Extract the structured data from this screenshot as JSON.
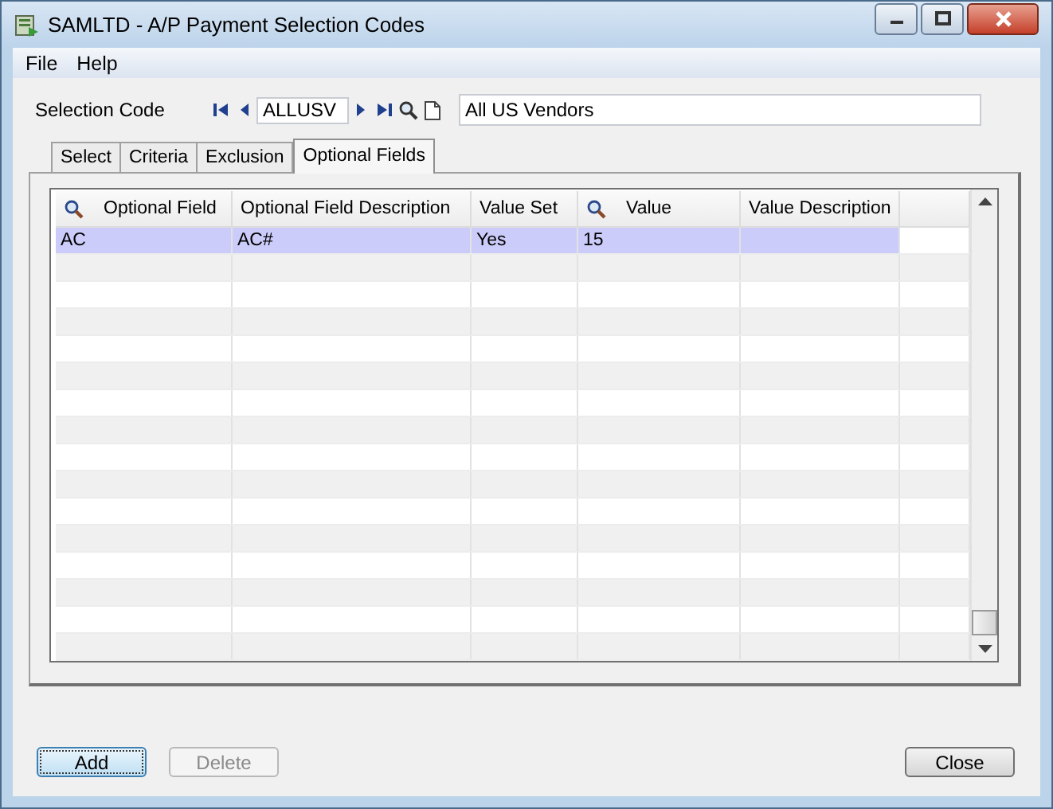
{
  "window": {
    "title": "SAMLTD - A/P Payment Selection Codes"
  },
  "menu": [
    "File",
    "Help"
  ],
  "selection_code": {
    "label": "Selection Code",
    "value": "ALLUSV",
    "description": "All US Vendors"
  },
  "tabs": [
    {
      "label": "Select",
      "selected": false
    },
    {
      "label": "Criteria",
      "selected": false
    },
    {
      "label": "Exclusion",
      "selected": false
    },
    {
      "label": "Optional Fields",
      "selected": true
    }
  ],
  "table": {
    "columns": [
      {
        "label": "Optional Field",
        "lookup": true
      },
      {
        "label": "Optional Field Description",
        "lookup": false
      },
      {
        "label": "Value Set",
        "lookup": false
      },
      {
        "label": "Value",
        "lookup": true
      },
      {
        "label": "Value Description",
        "lookup": false
      }
    ],
    "rows": [
      {
        "cells": [
          "AC",
          "AC#",
          "Yes",
          "15",
          ""
        ],
        "selected": true
      }
    ]
  },
  "buttons": [
    {
      "label": "Add",
      "disabled": false,
      "focused": true
    },
    {
      "label": "Delete",
      "disabled": true,
      "focused": false
    }
  ],
  "close_button": {
    "label": "Close"
  }
}
